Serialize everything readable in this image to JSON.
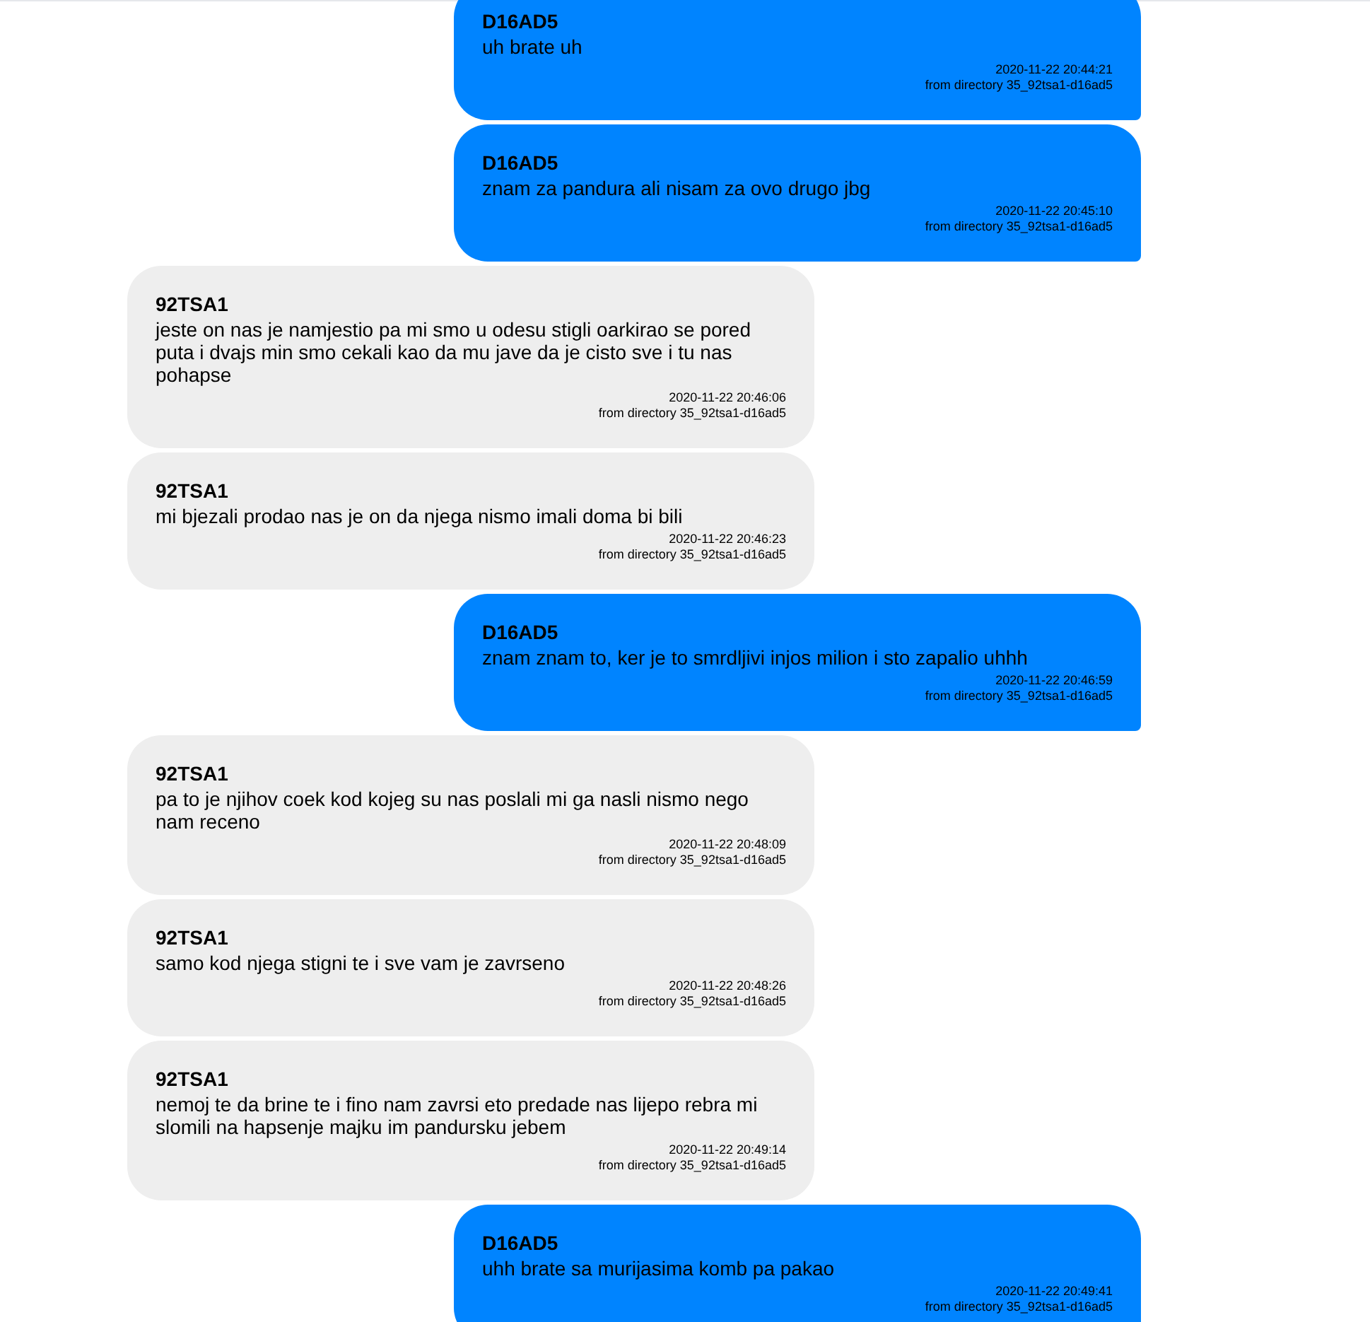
{
  "messages": [
    {
      "kind": "sent",
      "sender": "D16AD5",
      "text": "uh brate uh",
      "time": "2020-11-22 20:44:21",
      "source": "from directory 35_92tsa1-d16ad5"
    },
    {
      "kind": "sent",
      "sender": "D16AD5",
      "text": "znam za pandura ali nisam za ovo drugo jbg",
      "time": "2020-11-22 20:45:10",
      "source": "from directory 35_92tsa1-d16ad5"
    },
    {
      "kind": "received",
      "sender": "92TSA1",
      "text": "jeste on nas je namjestio pa mi smo u odesu stigli oarkirao se pored puta i dvajs min smo cekali kao da mu jave da je cisto sve i tu nas pohapse",
      "time": "2020-11-22 20:46:06",
      "source": "from directory 35_92tsa1-d16ad5"
    },
    {
      "kind": "received",
      "sender": "92TSA1",
      "text": "mi bjezali prodao nas je on da njega nismo imali doma bi bili",
      "time": "2020-11-22 20:46:23",
      "source": "from directory 35_92tsa1-d16ad5"
    },
    {
      "kind": "sent",
      "sender": "D16AD5",
      "text": "znam znam to, ker je to smrdljivi injos milion i sto zapalio uhhh",
      "time": "2020-11-22 20:46:59",
      "source": "from directory 35_92tsa1-d16ad5"
    },
    {
      "kind": "received",
      "sender": "92TSA1",
      "text": "pa to je njihov coek kod kojeg su nas poslali mi ga nasli nismo nego nam receno",
      "time": "2020-11-22 20:48:09",
      "source": "from directory 35_92tsa1-d16ad5"
    },
    {
      "kind": "received",
      "sender": "92TSA1",
      "text": "samo kod njega stigni te i sve vam je zavrseno",
      "time": "2020-11-22 20:48:26",
      "source": "from directory 35_92tsa1-d16ad5"
    },
    {
      "kind": "received",
      "sender": "92TSA1",
      "text": "nemoj te da brine te i fino nam zavrsi eto predade nas lijepo rebra mi slomili na hapsenje majku im pandursku jebem",
      "time": "2020-11-22 20:49:14",
      "source": "from directory 35_92tsa1-d16ad5"
    },
    {
      "kind": "sent",
      "sender": "D16AD5",
      "text": "uhh brate sa murijasima komb pa pakao",
      "time": "2020-11-22 20:49:41",
      "source": "from directory 35_92tsa1-d16ad5"
    }
  ]
}
